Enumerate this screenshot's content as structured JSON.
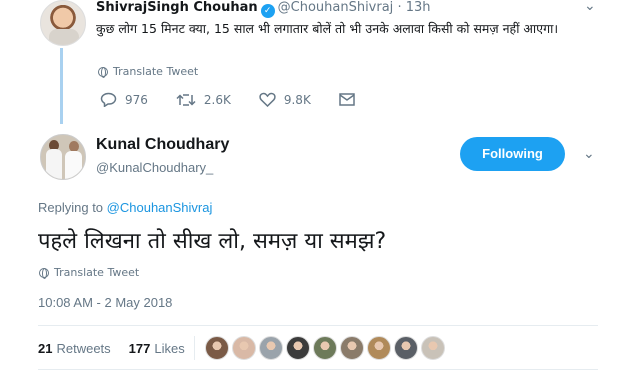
{
  "parent_tweet": {
    "name": "ShivrajSingh Chouhan",
    "handle": "@ChouhanShivraj",
    "time": "· 13h",
    "text": "कुछ लोग 15 मिनट क्या, 15 साल भी लगातार बोलें तो भी उनके अलावा किसी को समज़ नहीं आएगा।",
    "translate_label": "Translate Tweet",
    "replies": "976",
    "retweets": "2.6K",
    "likes": "9.8K"
  },
  "main_tweet": {
    "name": "Kunal Choudhary",
    "handle": "@KunalChoudhary_",
    "follow_label": "Following",
    "replying_prefix": "Replying to",
    "replying_handle": "@ChouhanShivraj",
    "text": "पहले लिखना तो सीख लो, समज़ या समझ?",
    "translate_label": "Translate Tweet",
    "timestamp": "10:08 AM - 2 May 2018",
    "retweets_count": "21",
    "retweets_label": "Retweets",
    "likes_count": "177",
    "likes_label": "Likes"
  },
  "colors": {
    "accent": "#1da1f2",
    "muted": "#657786",
    "thread_line": "#a9d1f0"
  },
  "liker_avatars": [
    {
      "color": "#7a5a46"
    },
    {
      "color": "#d9b9a6"
    },
    {
      "color": "#9aa3ab"
    },
    {
      "color": "#3b3b3b"
    },
    {
      "color": "#6d7a5a"
    },
    {
      "color": "#8a7b6a"
    },
    {
      "color": "#b08a5a"
    },
    {
      "color": "#5a5f66"
    },
    {
      "color": "#c9c2b8"
    }
  ]
}
